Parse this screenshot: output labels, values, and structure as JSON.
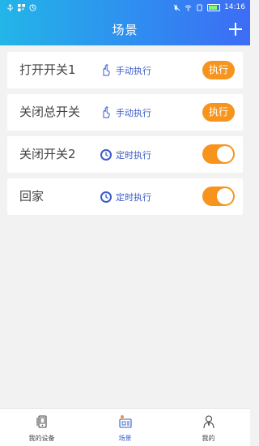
{
  "statusbar": {
    "time": "14:16"
  },
  "header": {
    "title": "场景"
  },
  "scenes": [
    {
      "name": "打开开关1",
      "mode": "手动执行",
      "action": "执行",
      "mode_icon": "hand-icon"
    },
    {
      "name": "关闭总开关",
      "mode": "手动执行",
      "action": "执行",
      "mode_icon": "hand-icon"
    },
    {
      "name": "关闭开关2",
      "mode": "定时执行",
      "toggle_on": true,
      "mode_icon": "clock-icon"
    },
    {
      "name": "回家",
      "mode": "定时执行",
      "toggle_on": true,
      "mode_icon": "clock-icon"
    }
  ],
  "nav": {
    "items": [
      {
        "label": "我的设备",
        "icon": "device-icon"
      },
      {
        "label": "场景",
        "icon": "scene-icon",
        "active": true
      },
      {
        "label": "我的",
        "icon": "profile-icon"
      }
    ]
  },
  "colors": {
    "accent": "#f7941d",
    "blue": "#3a5bc7",
    "header_start": "#23b5e8",
    "header_end": "#3d6cf5"
  }
}
